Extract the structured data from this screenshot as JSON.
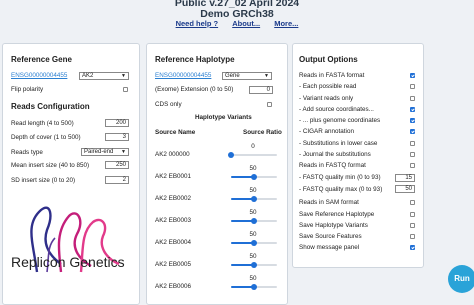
{
  "header": {
    "title": "Public v.27_02 April 2024",
    "subtitle": "Demo GRCh38",
    "links": [
      "Need help ?",
      "About...",
      "More..."
    ]
  },
  "reference_gene": {
    "heading": "Reference Gene",
    "gene_id": "ENSG00000004455",
    "gene_select": "AK2",
    "flip_label": "Flip polarity",
    "flip_checked": false
  },
  "reads_configuration": {
    "heading": "Reads Configuration",
    "fields": [
      {
        "label": "Read length (4 to 500)",
        "value": "200"
      },
      {
        "label": "Depth of cover (1 to 500)",
        "value": "3"
      }
    ],
    "reads_type_label": "Reads type",
    "reads_type_value": "Paired-end",
    "fields2": [
      {
        "label": "Mean insert size (40 to 850)",
        "value": "250"
      },
      {
        "label": "SD insert size (0 to 20)",
        "value": "2"
      }
    ]
  },
  "logo": {
    "company": "Replicon Genetics"
  },
  "reference_haplotype": {
    "heading": "Reference Haplotype",
    "gene_id": "ENSG00000004455",
    "gene_select": "Gene",
    "exome_label": "(Exome) Extension (0 to 50)",
    "exome_value": "0",
    "cds_label": "CDS only",
    "cds_checked": false,
    "variants_heading": "Haplotype Variants",
    "col_source": "Source Name",
    "col_ratio": "Source Ratio",
    "variants": [
      {
        "name": "AK2 000000",
        "ratio": 0
      },
      {
        "name": "AK2 EB0001",
        "ratio": 50
      },
      {
        "name": "AK2 EB0002",
        "ratio": 50
      },
      {
        "name": "AK2 EB0003",
        "ratio": 50
      },
      {
        "name": "AK2 EB0004",
        "ratio": 50
      },
      {
        "name": "AK2 EB0005",
        "ratio": 50
      },
      {
        "name": "AK2 EB0006",
        "ratio": 50
      }
    ]
  },
  "output_options": {
    "heading": "Output Options",
    "items": [
      {
        "label": "Reads in FASTA format",
        "checked": true
      },
      {
        "label": "- Each possible read",
        "checked": false
      },
      {
        "label": "- Variant reads only",
        "checked": false
      },
      {
        "label": "- Add source coordinates...",
        "checked": true
      },
      {
        "label": "- ... plus genome coordinates",
        "checked": true
      },
      {
        "label": "- CIGAR annotation",
        "checked": true
      },
      {
        "label": "- Substitutions in lower case",
        "checked": false
      },
      {
        "label": "- Journal the substitutions",
        "checked": false
      },
      {
        "label": "Reads in FASTQ format",
        "checked": false
      }
    ],
    "qual_min_label": "- FASTQ quality min (0 to 93)",
    "qual_min_value": "15",
    "qual_max_label": "- FASTQ quality max (0 to 93)",
    "qual_max_value": "50",
    "items2": [
      {
        "label": "Reads in SAM format",
        "checked": false
      },
      {
        "label": "Save Reference Haplotype",
        "checked": false
      },
      {
        "label": "Save Haplotype Variants",
        "checked": false
      },
      {
        "label": "Save Source Features",
        "checked": false
      },
      {
        "label": "Show message panel",
        "checked": true
      }
    ]
  },
  "run_button": "Run"
}
